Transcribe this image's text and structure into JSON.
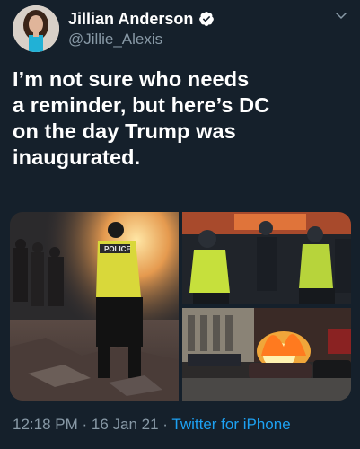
{
  "tweet": {
    "author": {
      "display_name": "Jillian Anderson",
      "handle": "@Jillie_Alexis",
      "verified": true
    },
    "text": "I’m not sure who needs\na reminder, but here’s DC\non the day Trump was\ninaugurated.",
    "media": {
      "police_vest_text": "POLICE"
    },
    "meta": {
      "time": "12:18 PM",
      "separator_1": " · ",
      "date": "16 Jan 21",
      "separator_2": " · ",
      "source": "Twitter for iPhone"
    }
  },
  "colors": {
    "background": "#15202b",
    "text_primary": "#ffffff",
    "text_secondary": "#8899a6",
    "link": "#1da1f2",
    "verified_badge": "#ffffff"
  },
  "icons": [
    "verified-badge-icon",
    "chevron-down-icon"
  ]
}
